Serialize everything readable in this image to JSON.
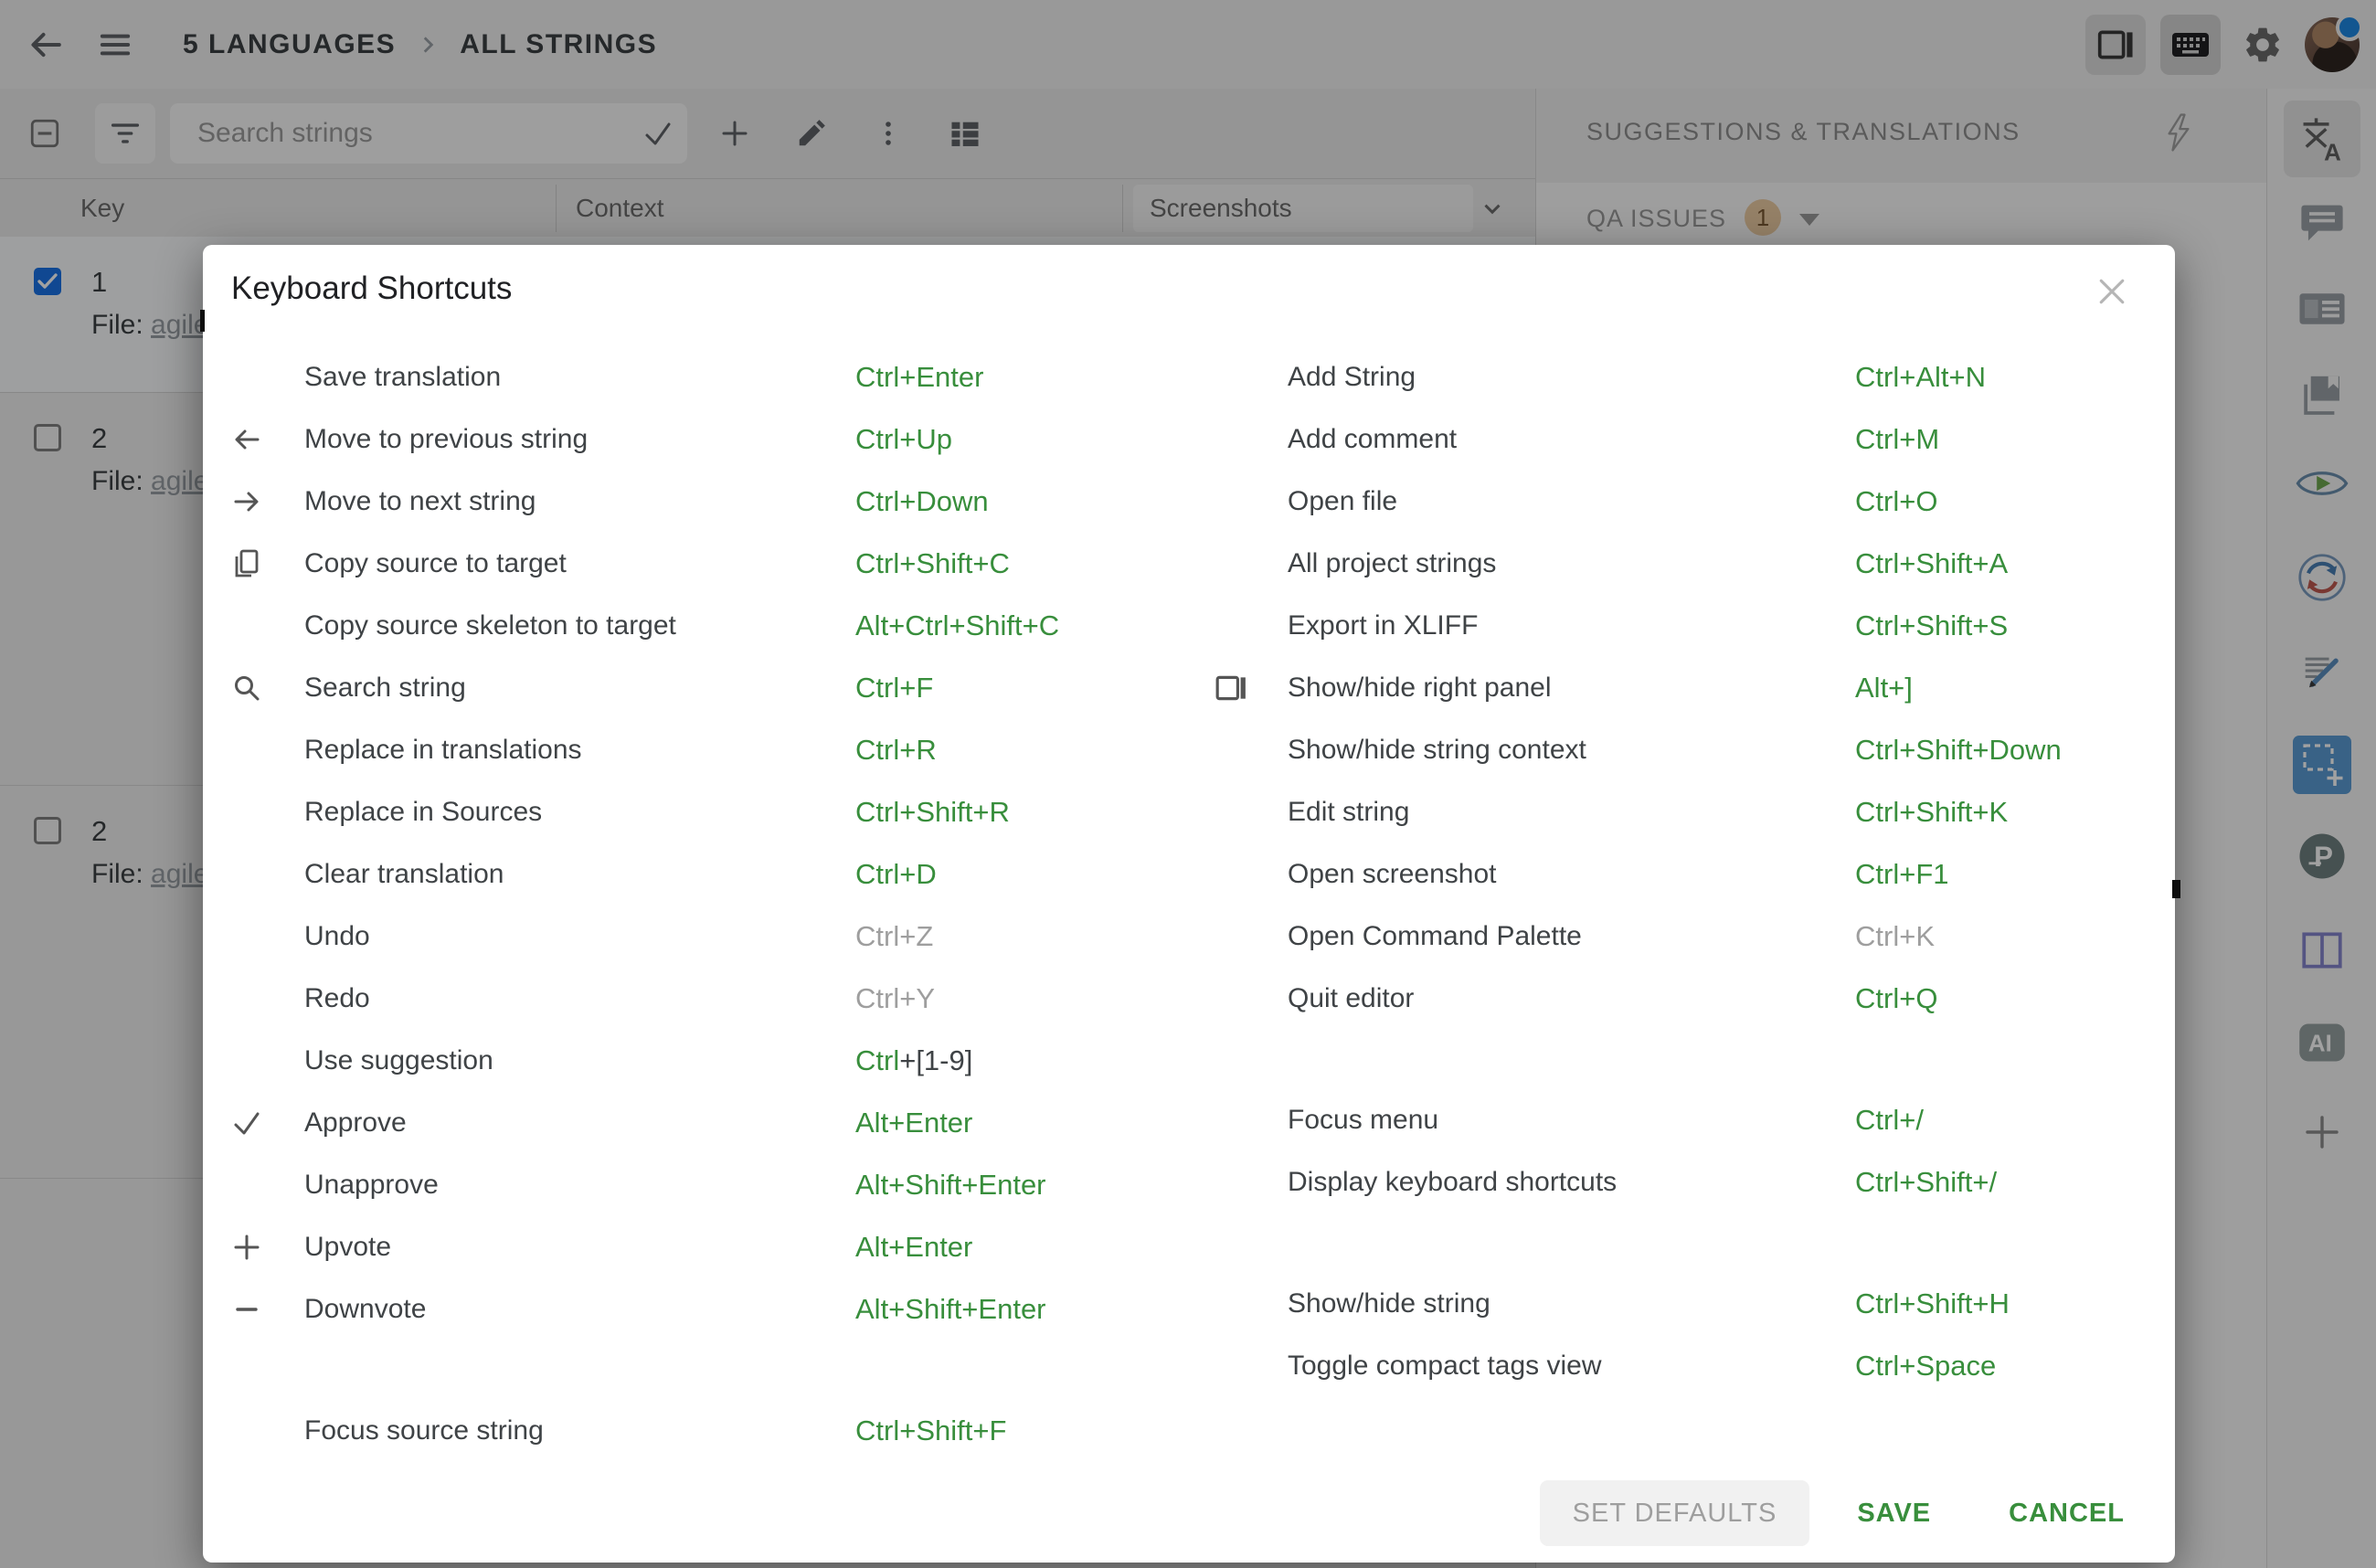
{
  "header": {
    "breadcrumb": [
      "5 LANGUAGES",
      "ALL STRINGS"
    ]
  },
  "toolbar": {
    "search_placeholder": "Search strings",
    "action_icons": [
      "check-icon",
      "plus-icon",
      "pencil-icon",
      "kebab-menu-icon",
      "list-view-icon"
    ]
  },
  "table": {
    "columns": [
      "Key",
      "Context",
      "Screenshots"
    ],
    "rows": [
      {
        "key": "1",
        "file_prefix": "File:",
        "file_link": "agile",
        "checked": true,
        "selected": true
      },
      {
        "key": "2",
        "file_prefix": "File:",
        "file_link": "agile",
        "checked": false,
        "selected": false
      },
      {
        "key": "2",
        "file_prefix": "File:",
        "file_link": "agile",
        "checked": false,
        "selected": false
      }
    ]
  },
  "right_panel": {
    "title": "SUGGESTIONS & TRANSLATIONS",
    "qa_label": "QA ISSUES",
    "qa_count": "1"
  },
  "sidebar": {
    "icons": [
      {
        "name": "translate-icon",
        "active": true
      },
      {
        "name": "comments-icon",
        "active": false
      },
      {
        "name": "string-info-icon",
        "active": false
      },
      {
        "name": "screenshots-icon",
        "active": false
      },
      {
        "name": "preview-icon",
        "active": false
      },
      {
        "name": "translation-memory-icon",
        "active": false
      },
      {
        "name": "draft-icon",
        "active": false
      },
      {
        "name": "select-area-icon",
        "active": false
      },
      {
        "name": "project-terms-icon",
        "active": false
      },
      {
        "name": "split-view-icon",
        "active": false
      },
      {
        "name": "ai-icon",
        "active": false
      },
      {
        "name": "add-panel-icon",
        "active": false
      }
    ]
  },
  "modal": {
    "title": "Keyboard Shortcuts",
    "columns": [
      {
        "rows": [
          {
            "icon": null,
            "label": "Save translation",
            "keys": [
              [
                "Ctrl+Enter",
                "green"
              ]
            ],
            "gap": false
          },
          {
            "icon": "arrow-left-icon",
            "label": "Move to previous string",
            "keys": [
              [
                "Ctrl+Up",
                "green"
              ]
            ],
            "gap": false
          },
          {
            "icon": "arrow-right-icon",
            "label": "Move to next string",
            "keys": [
              [
                "Ctrl+Down",
                "green"
              ]
            ],
            "gap": false
          },
          {
            "icon": "copy-icon",
            "label": "Copy source to target",
            "keys": [
              [
                "Ctrl+Shift+C",
                "green"
              ]
            ],
            "gap": false
          },
          {
            "icon": null,
            "label": "Copy source skeleton to target",
            "keys": [
              [
                "Alt+Ctrl+Shift+C",
                "green"
              ]
            ],
            "gap": false
          },
          {
            "icon": "search-icon",
            "label": "Search string",
            "keys": [
              [
                "Ctrl+F",
                "green"
              ]
            ],
            "gap": false
          },
          {
            "icon": null,
            "label": "Replace in translations",
            "keys": [
              [
                "Ctrl+R",
                "green"
              ]
            ],
            "gap": false
          },
          {
            "icon": null,
            "label": "Replace in Sources",
            "keys": [
              [
                "Ctrl+Shift+R",
                "green"
              ]
            ],
            "gap": false
          },
          {
            "icon": null,
            "label": "Clear translation",
            "keys": [
              [
                "Ctrl+D",
                "green"
              ]
            ],
            "gap": false
          },
          {
            "icon": null,
            "label": "Undo",
            "keys": [
              [
                "Ctrl+Z",
                "gray"
              ]
            ],
            "gap": false
          },
          {
            "icon": null,
            "label": "Redo",
            "keys": [
              [
                "Ctrl+Y",
                "gray"
              ]
            ],
            "gap": false
          },
          {
            "icon": null,
            "label": "Use suggestion",
            "keys": [
              [
                "Ctrl",
                "green"
              ],
              [
                "+[1-9]",
                "dark"
              ]
            ],
            "gap": false
          },
          {
            "icon": "check-icon",
            "label": "Approve",
            "keys": [
              [
                "Alt+Enter",
                "green"
              ]
            ],
            "gap": false
          },
          {
            "icon": null,
            "label": "Unapprove",
            "keys": [
              [
                "Alt+Shift+Enter",
                "green"
              ]
            ],
            "gap": false
          },
          {
            "icon": "plus-icon",
            "label": "Upvote",
            "keys": [
              [
                "Alt+Enter",
                "green"
              ]
            ],
            "gap": false
          },
          {
            "icon": "minus-icon",
            "label": "Downvote",
            "keys": [
              [
                "Alt+Shift+Enter",
                "green"
              ]
            ],
            "gap": false
          },
          {
            "icon": null,
            "label": "Focus source string",
            "keys": [
              [
                "Ctrl+Shift+F",
                "green"
              ]
            ],
            "gap": true
          }
        ]
      },
      {
        "rows": [
          {
            "icon": null,
            "label": "Add String",
            "keys": [
              [
                "Ctrl+Alt+N",
                "green"
              ]
            ],
            "gap": false
          },
          {
            "icon": null,
            "label": "Add comment",
            "keys": [
              [
                "Ctrl+M",
                "green"
              ]
            ],
            "gap": false
          },
          {
            "icon": null,
            "label": "Open file",
            "keys": [
              [
                "Ctrl+O",
                "green"
              ]
            ],
            "gap": false
          },
          {
            "icon": null,
            "label": "All project strings",
            "keys": [
              [
                "Ctrl+Shift+A",
                "green"
              ]
            ],
            "gap": false
          },
          {
            "icon": null,
            "label": "Export in XLIFF",
            "keys": [
              [
                "Ctrl+Shift+S",
                "green"
              ]
            ],
            "gap": false
          },
          {
            "icon": "panel-icon",
            "label": "Show/hide right panel",
            "keys": [
              [
                "Alt+]",
                "green"
              ]
            ],
            "gap": false
          },
          {
            "icon": null,
            "label": "Show/hide string context",
            "keys": [
              [
                "Ctrl+Shift+Down",
                "green"
              ]
            ],
            "gap": false
          },
          {
            "icon": null,
            "label": "Edit string",
            "keys": [
              [
                "Ctrl+Shift+K",
                "green"
              ]
            ],
            "gap": false
          },
          {
            "icon": null,
            "label": "Open screenshot",
            "keys": [
              [
                "Ctrl+F1",
                "green"
              ]
            ],
            "gap": false
          },
          {
            "icon": null,
            "label": "Open Command Palette",
            "keys": [
              [
                "Ctrl+K",
                "gray"
              ]
            ],
            "gap": false
          },
          {
            "icon": null,
            "label": "Quit editor",
            "keys": [
              [
                "Ctrl+Q",
                "green"
              ]
            ],
            "gap": false
          },
          {
            "icon": null,
            "label": "Focus menu",
            "keys": [
              [
                "Ctrl+/",
                "green"
              ]
            ],
            "gap": true
          },
          {
            "icon": null,
            "label": "Display keyboard shortcuts",
            "keys": [
              [
                "Ctrl+Shift+/",
                "green"
              ]
            ],
            "gap": false
          },
          {
            "icon": null,
            "label": "Show/hide string",
            "keys": [
              [
                "Ctrl+Shift+H",
                "green"
              ]
            ],
            "gap": true
          },
          {
            "icon": null,
            "label": "Toggle compact tags view",
            "keys": [
              [
                "Ctrl+Space",
                "green"
              ]
            ],
            "gap": false
          }
        ]
      }
    ],
    "footer": {
      "set_defaults": "SET DEFAULTS",
      "save": "SAVE",
      "cancel": "CANCEL"
    }
  },
  "colors": {
    "accent_green": "#388e3c",
    "checkbox_blue": "#1a73e8",
    "muted_gray": "#9e9e9e"
  }
}
